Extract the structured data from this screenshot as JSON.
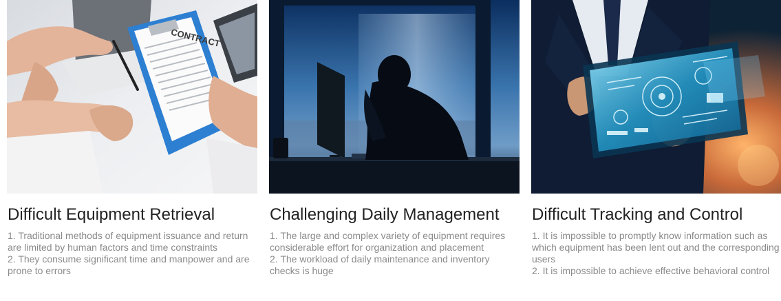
{
  "cards": [
    {
      "title": "Difficult Equipment Retrieval",
      "image_caption": "CONTRACT",
      "points": [
        "1. Traditional methods of equipment issuance and return are limited by human factors and time constraints",
        "2. They consume significant time and manpower and are prone to errors"
      ]
    },
    {
      "title": "Challenging Daily Management",
      "points": [
        "1. The large and complex variety of equipment requires considerable effort for organization and placement",
        "2. The workload of daily maintenance and inventory checks is huge"
      ]
    },
    {
      "title": "Difficult Tracking and Control",
      "points": [
        "1. It is impossible to promptly know information such as which equipment has been lent out and the corresponding users",
        "2. It is impossible to achieve effective behavioral control"
      ]
    }
  ]
}
